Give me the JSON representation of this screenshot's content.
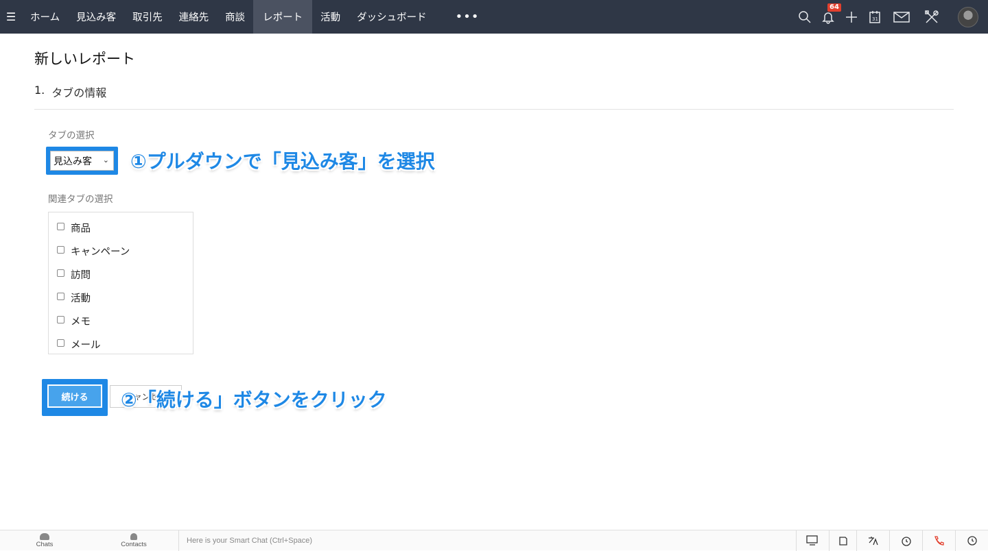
{
  "topbar": {
    "nav_items": [
      "ホーム",
      "見込み客",
      "取引先",
      "連絡先",
      "商談",
      "レポート",
      "活動",
      "ダッシュボード"
    ],
    "active_index": 5,
    "more_label": "•••",
    "notification_count": "64",
    "icons": [
      "search-icon",
      "bell-icon",
      "plus-icon",
      "calendar-icon",
      "mail-icon",
      "tools-icon"
    ],
    "calendar_day": "31"
  },
  "page": {
    "title": "新しいレポート",
    "section_number": "1.",
    "section_title": "タブの情報",
    "tab_select_label": "タブの選択",
    "tab_select_value": "見込み客",
    "related_tab_label": "関連タブの選択",
    "related_tabs": [
      "商品",
      "キャンペーン",
      "訪問",
      "活動",
      "メモ",
      "メール"
    ],
    "continue_label": "続ける",
    "cancel_label": "キャンセル"
  },
  "annotations": {
    "step1": "①プルダウンで「見込み客」を選択",
    "step2": "②「続ける」ボタンをクリック",
    "highlight_color": "#1e88e5"
  },
  "bottombar": {
    "chats_label": "Chats",
    "contacts_label": "Contacts",
    "chat_placeholder": "Here is your Smart Chat (Ctrl+Space)"
  }
}
